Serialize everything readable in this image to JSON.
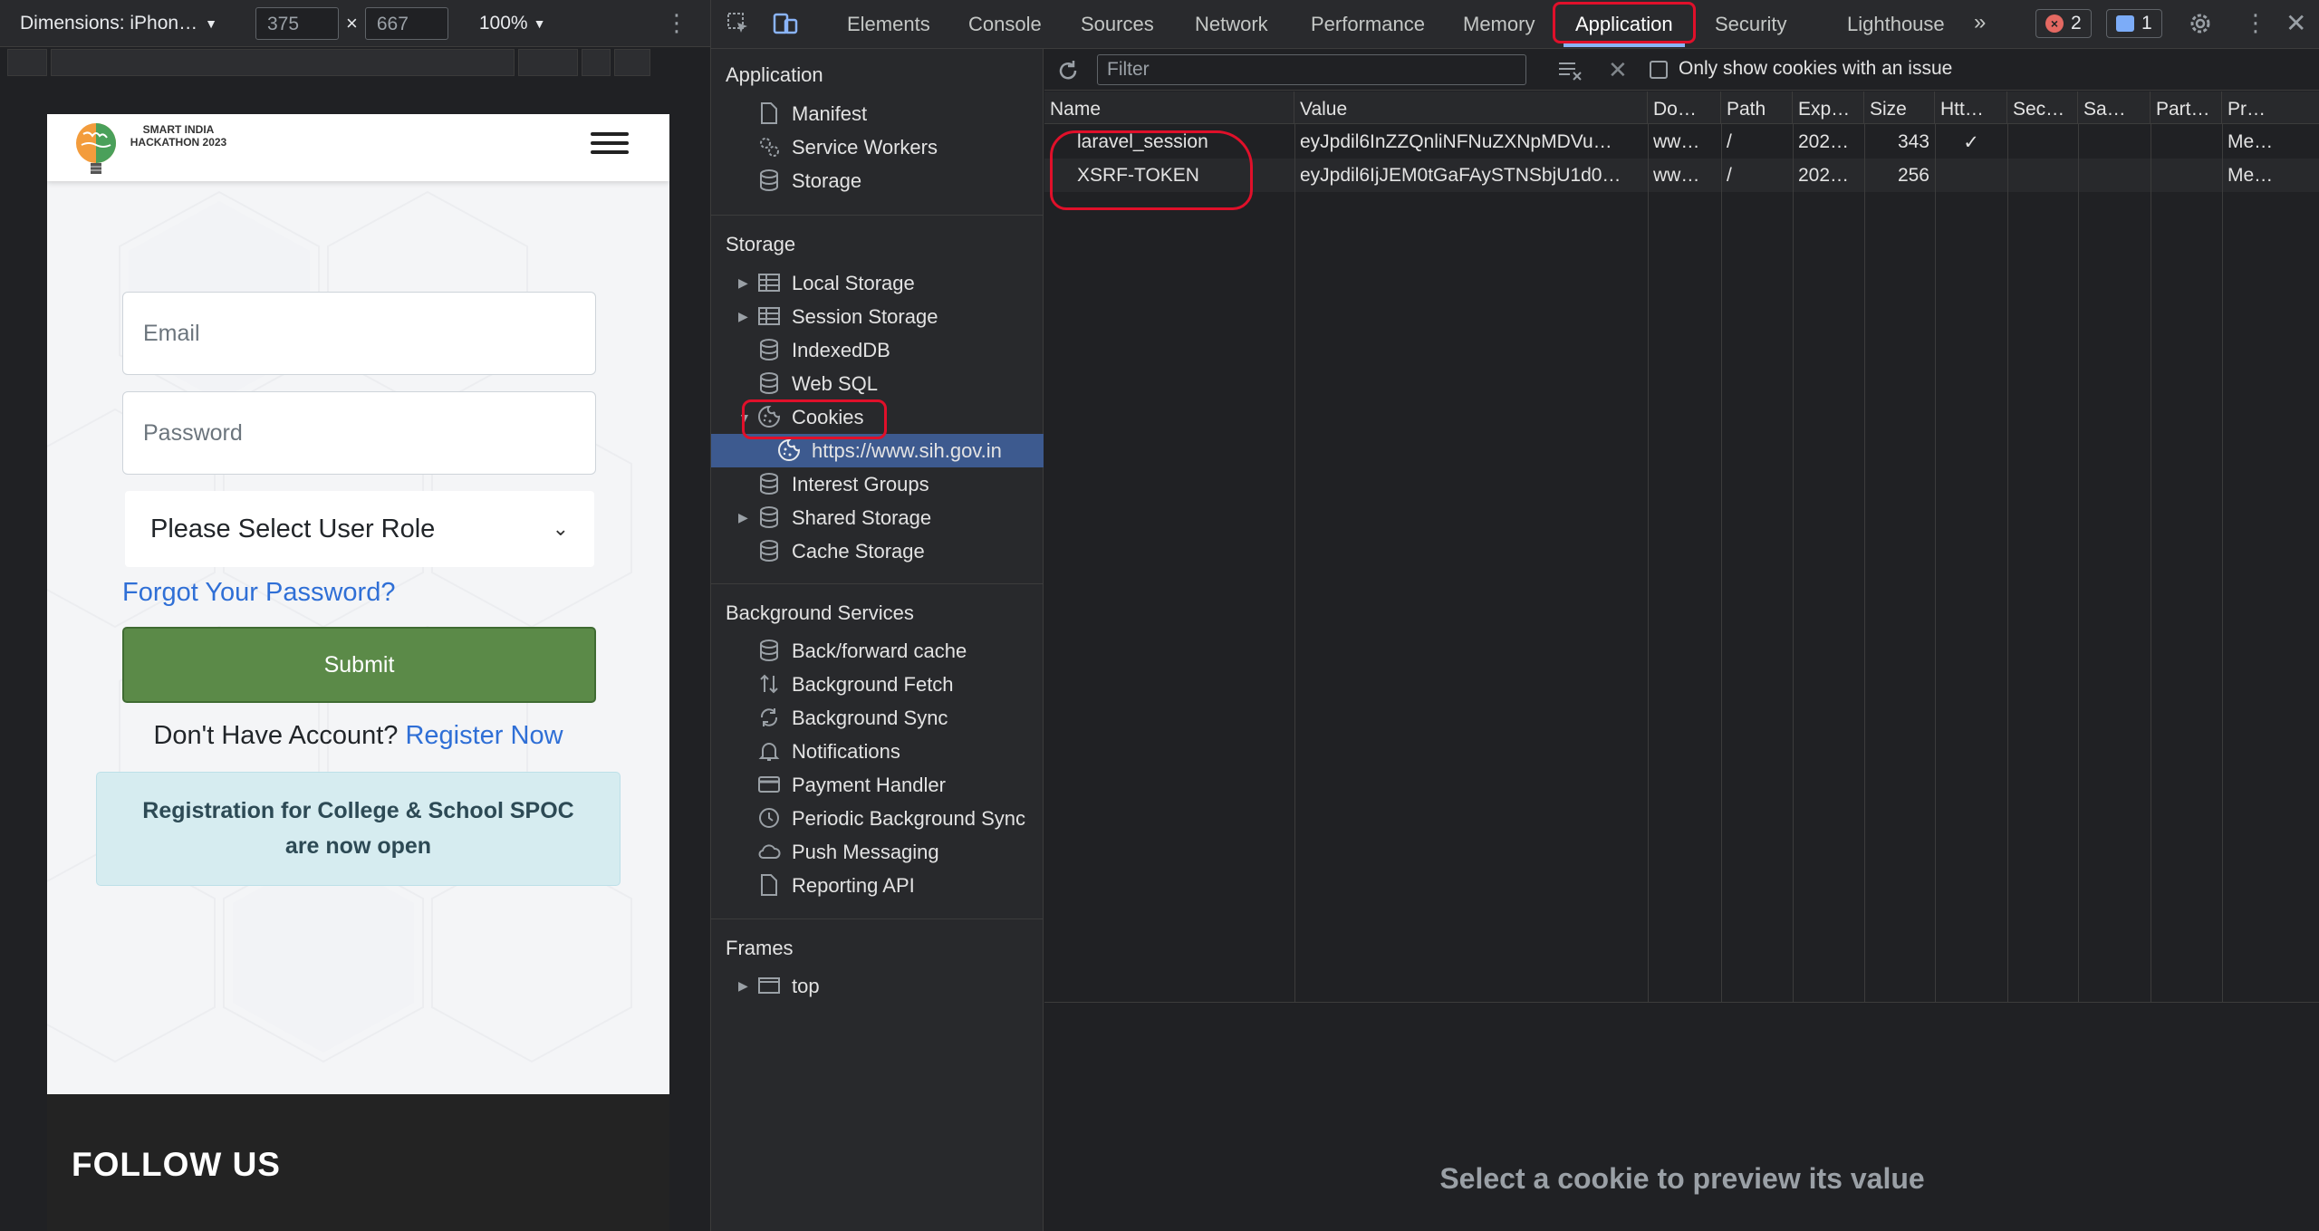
{
  "device_toolbar": {
    "dimensions_label": "Dimensions: iPhon…",
    "width": "375",
    "height": "667",
    "times": "×",
    "zoom": "100%"
  },
  "site": {
    "logo_text": "SMART INDIA HACKATHON 2023",
    "email_placeholder": "Email",
    "password_placeholder": "Password",
    "role_select": "Please Select User Role",
    "forgot_password": "Forgot Your Password?",
    "submit": "Submit",
    "no_account": "Don't Have Account?",
    "register": "Register Now",
    "notice": "Registration for College & School SPOC are now open",
    "follow_us": "FOLLOW US"
  },
  "devtools": {
    "tabs": [
      "Elements",
      "Console",
      "Sources",
      "Network",
      "Performance",
      "Memory",
      "Application",
      "Security",
      "Lighthouse"
    ],
    "active_tab": "Application",
    "more_tabs": "»",
    "error_count": "2",
    "message_count": "1"
  },
  "sidebar": {
    "application_title": "Application",
    "application_items": [
      "Manifest",
      "Service Workers",
      "Storage"
    ],
    "storage_title": "Storage",
    "storage_items": [
      "Local Storage",
      "Session Storage",
      "IndexedDB",
      "Web SQL",
      "Cookies",
      "https://www.sih.gov.in",
      "Interest Groups",
      "Shared Storage",
      "Cache Storage"
    ],
    "background_title": "Background Services",
    "background_items": [
      "Back/forward cache",
      "Background Fetch",
      "Background Sync",
      "Notifications",
      "Payment Handler",
      "Periodic Background Sync",
      "Push Messaging",
      "Reporting API"
    ],
    "frames_title": "Frames",
    "frames_items": [
      "top"
    ]
  },
  "cookies": {
    "filter_placeholder": "Filter",
    "only_issue_label": "Only show cookies with an issue",
    "columns": [
      "Name",
      "Value",
      "Do…",
      "Path",
      "Exp…",
      "Size",
      "Htt…",
      "Sec…",
      "Sa…",
      "Part…",
      "Pr…"
    ],
    "rows": [
      [
        "laravel_session",
        "eyJpdil6InZZQnliNFNuZXNpMDVu…",
        "ww…",
        "/",
        "202…",
        "343",
        "✓",
        "",
        "",
        "",
        "Me…"
      ],
      [
        "XSRF-TOKEN",
        "eyJpdil6IjJEM0tGaFAySTNSbjU1d0…",
        "ww…",
        "/",
        "202…",
        "256",
        "",
        "",
        "",
        "",
        "Me…"
      ]
    ],
    "preview_text": "Select a cookie to preview its value"
  },
  "colors": {
    "highlight": "#e0102a",
    "accent": "#8ab4f8",
    "selected_row": "#3d5a8f",
    "submit_green": "#5b8a48"
  }
}
